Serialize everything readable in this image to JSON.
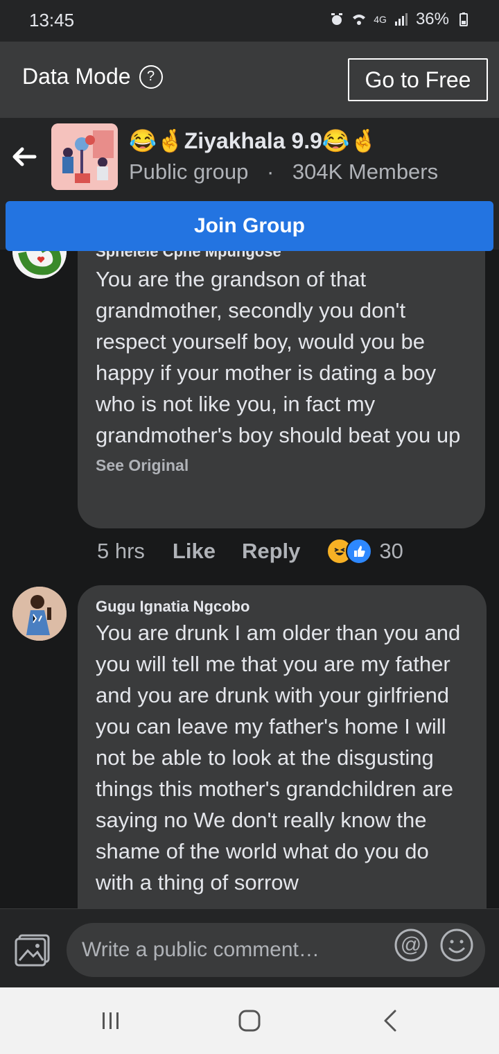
{
  "status_bar": {
    "time": "13:45",
    "network": "4G",
    "battery": "36%"
  },
  "data_mode": {
    "label": "Data Mode",
    "help": "?",
    "go_free_label": "Go to Free"
  },
  "group": {
    "title": "😂🤞Ziyakhala 9.9😂🤞",
    "privacy": "Public group",
    "separator": "·",
    "members": "304K Members",
    "join_label": "Join Group"
  },
  "comments": [
    {
      "author": "Sphelele Cphe Mpungose",
      "text": "You are the grandson of that grandmother, secondly you don't respect yourself boy, would you be happy if your mother is dating a boy who is not like you, in fact my grandmother's boy should beat you up",
      "see_original": "See Original",
      "time": "5 hrs",
      "like": "Like",
      "reply": "Reply",
      "reaction_count": "30"
    },
    {
      "author": "Gugu Ignatia Ngcobo",
      "text": "You are drunk I am older than you and you will tell me that you are my father and you are drunk with your girlfriend you can leave my father's home I will not be able to look at the disgusting things this mother's grandchildren are saying no We don't really know the shame of the world what do you do with a thing of sorrow"
    }
  ],
  "composer": {
    "placeholder": "Write a public comment…"
  },
  "colors": {
    "accent": "#2374e1",
    "bubble": "#3a3b3c",
    "background": "#18191a"
  }
}
